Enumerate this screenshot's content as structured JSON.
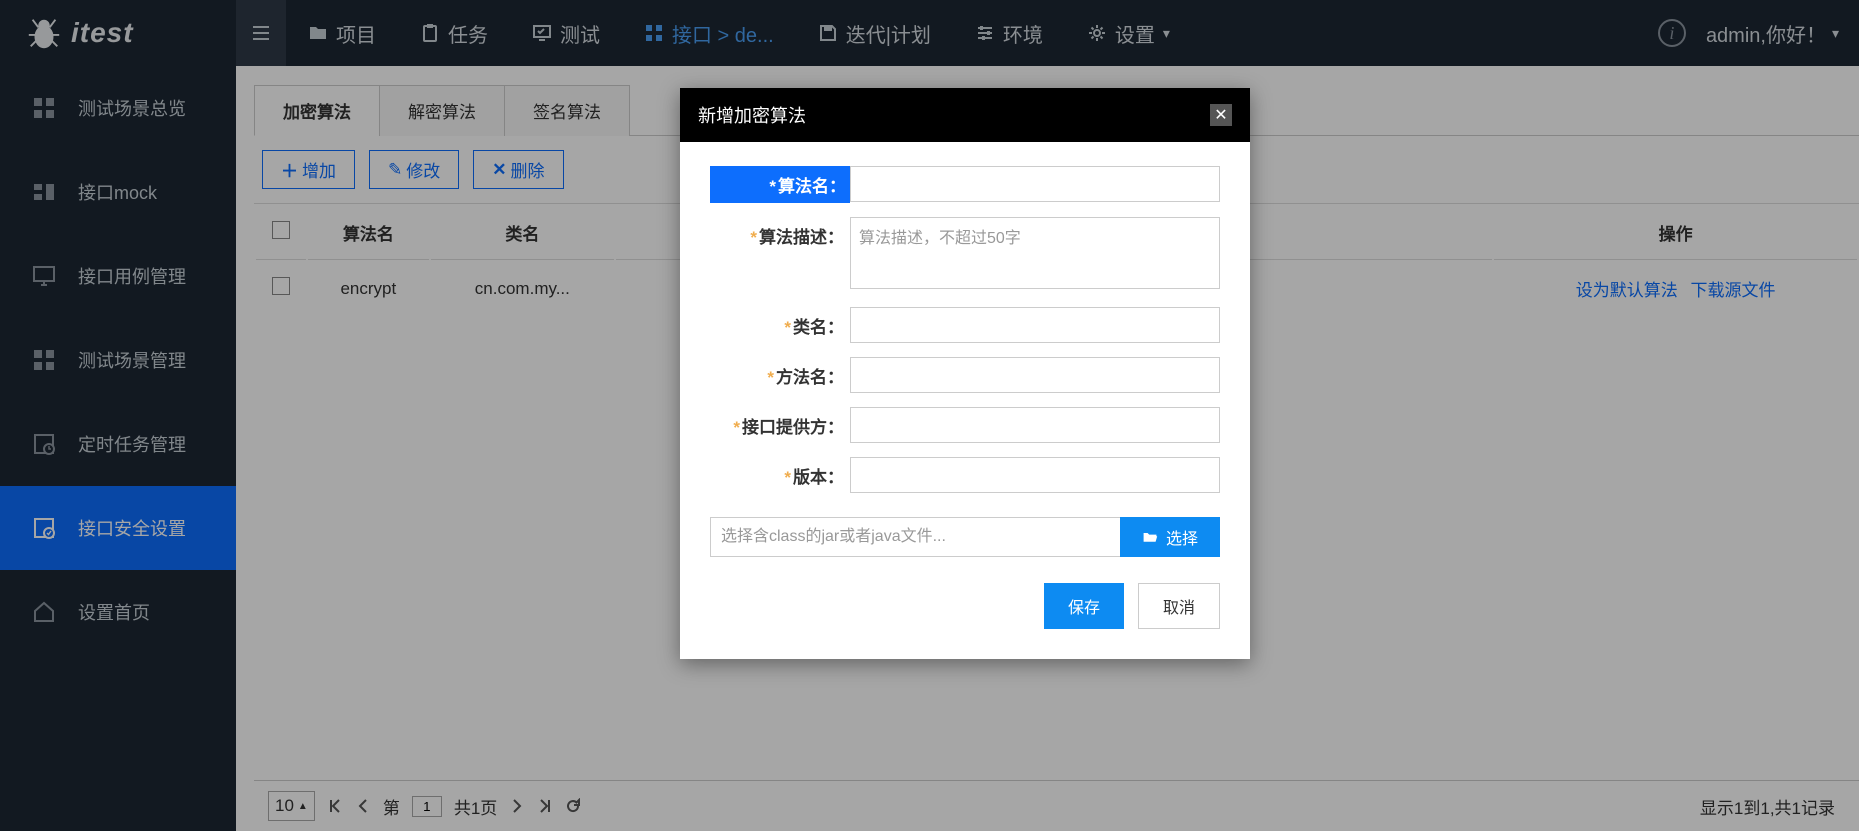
{
  "logo_text": "itest",
  "topnav": {
    "items": [
      "项目",
      "任务",
      "测试",
      "接口 > de...",
      "迭代|计划",
      "环境",
      "设置"
    ],
    "user": "admin,你好！"
  },
  "sidebar": {
    "items": [
      "测试场景总览",
      "接口mock",
      "接口用例管理",
      "测试场景管理",
      "定时任务管理",
      "接口安全设置",
      "设置首页"
    ],
    "active_index": 5
  },
  "tabs": {
    "items": [
      "加密算法",
      "解密算法",
      "签名算法"
    ],
    "active_index": 0
  },
  "toolbar": {
    "add": "增加",
    "edit": "修改",
    "delete": "删除"
  },
  "table": {
    "headers": {
      "name": "算法名",
      "classname": "类名",
      "op": "操作"
    },
    "rows": [
      {
        "name": "encrypt",
        "classname": "cn.com.my...",
        "op_default": "设为默认算法",
        "op_download": "下载源文件"
      }
    ]
  },
  "pager": {
    "pagesize": "10",
    "page_label_pre": "第",
    "page_value": "1",
    "page_label_post": "共1页",
    "info": "显示1到1,共1记录"
  },
  "modal": {
    "title": "新增加密算法",
    "labels": {
      "name": "算法名：",
      "desc": "算法描述：",
      "classname": "类名：",
      "method": "方法名：",
      "provider": "接口提供方：",
      "version": "版本："
    },
    "desc_placeholder": "算法描述，不超过50字",
    "file_placeholder": "选择含class的jar或者java文件...",
    "file_btn": "选择",
    "save": "保存",
    "cancel": "取消"
  }
}
